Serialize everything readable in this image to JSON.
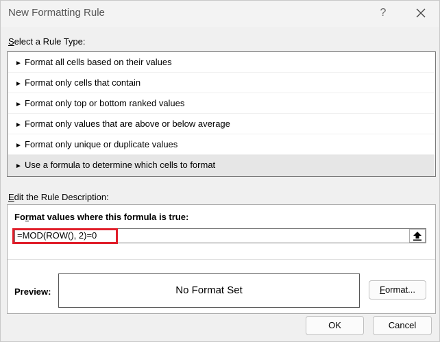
{
  "window": {
    "title": "New Formatting Rule",
    "help_label": "?",
    "close_icon": "close-icon"
  },
  "rule_type": {
    "label_prefix": "S",
    "label_rest": "elect a Rule Type:",
    "items": [
      {
        "arrow": "►",
        "label": "Format all cells based on their values",
        "selected": false
      },
      {
        "arrow": "►",
        "label": "Format only cells that contain",
        "selected": false
      },
      {
        "arrow": "►",
        "label": "Format only top or bottom ranked values",
        "selected": false
      },
      {
        "arrow": "►",
        "label": "Format only values that are above or below average",
        "selected": false
      },
      {
        "arrow": "►",
        "label": "Format only unique or duplicate values",
        "selected": false
      },
      {
        "arrow": "►",
        "label": "Use a formula to determine which cells to format",
        "selected": true
      }
    ]
  },
  "description": {
    "label_prefix": "E",
    "label_rest": "dit the Rule Description:",
    "formula_heading_prefix": "Fo",
    "formula_heading_u": "r",
    "formula_heading_rest": "mat values where this formula is true:",
    "formula_value": "=MOD(ROW(), 2)=0",
    "highlight_color": "#e01e2a",
    "preview_label": "Preview:",
    "preview_text": "No Format Set",
    "format_button_u": "F",
    "format_button_rest": "ormat..."
  },
  "footer": {
    "ok_label": "OK",
    "cancel_label": "Cancel"
  }
}
